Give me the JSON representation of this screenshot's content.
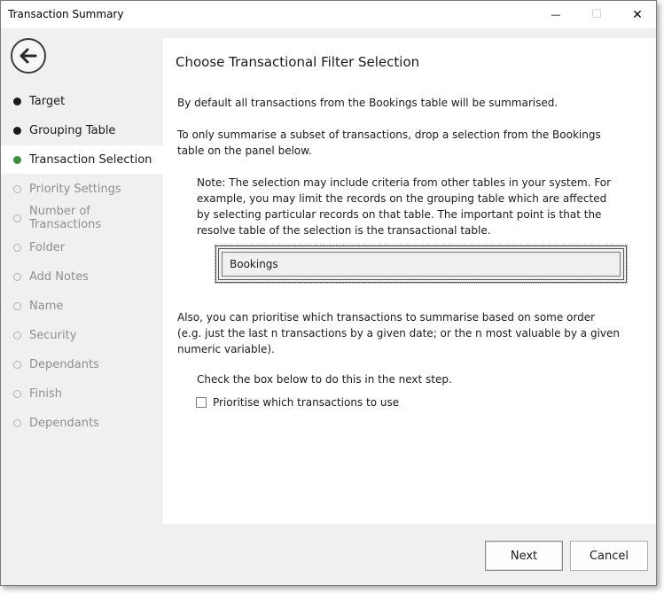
{
  "window": {
    "title": "Transaction Summary",
    "minimize_glyph": "—",
    "maximize_glyph": "☐",
    "close_glyph": "✕"
  },
  "sidebar": {
    "back_icon": "arrow-left-icon",
    "steps": [
      {
        "label": "Target",
        "state": "done"
      },
      {
        "label": "Grouping Table",
        "state": "done"
      },
      {
        "label": "Transaction Selection",
        "state": "current"
      },
      {
        "label": "Priority Settings",
        "state": "pending"
      },
      {
        "label": "Number of Transactions",
        "state": "pending"
      },
      {
        "label": "Folder",
        "state": "pending"
      },
      {
        "label": "Add Notes",
        "state": "pending"
      },
      {
        "label": "Name",
        "state": "pending"
      },
      {
        "label": "Security",
        "state": "pending"
      },
      {
        "label": "Dependants",
        "state": "pending"
      },
      {
        "label": "Finish",
        "state": "pending"
      },
      {
        "label": "Dependants",
        "state": "pending"
      }
    ]
  },
  "main": {
    "heading": "Choose Transactional Filter Selection",
    "para1": "By default all transactions from the Bookings table will be summarised.",
    "para2": "To only summarise a subset of transactions, drop a selection from the Bookings table on the panel below.",
    "note": "Note: The selection may include criteria from other tables in your system. For example, you may limit the records on the grouping table which are affected by selecting particular records on that table. The important point is that the resolve table of the selection is the transactional table.",
    "drop_panel_value": "Bookings",
    "para3": "Also, you can prioritise which transactions to summarise based on some order (e.g. just the last n transactions by a given date; or the n most valuable by a given numeric  variable).",
    "check_note": "Check the box below to do this in the next step.",
    "checkbox_label": "Prioritise which transactions to use",
    "checkbox_checked": false
  },
  "footer": {
    "next_label": "Next",
    "cancel_label": "Cancel"
  },
  "colors": {
    "current_step": "#3a8f3a",
    "done_step": "#1a1a1a",
    "pending_step": "#b0b0b0"
  }
}
